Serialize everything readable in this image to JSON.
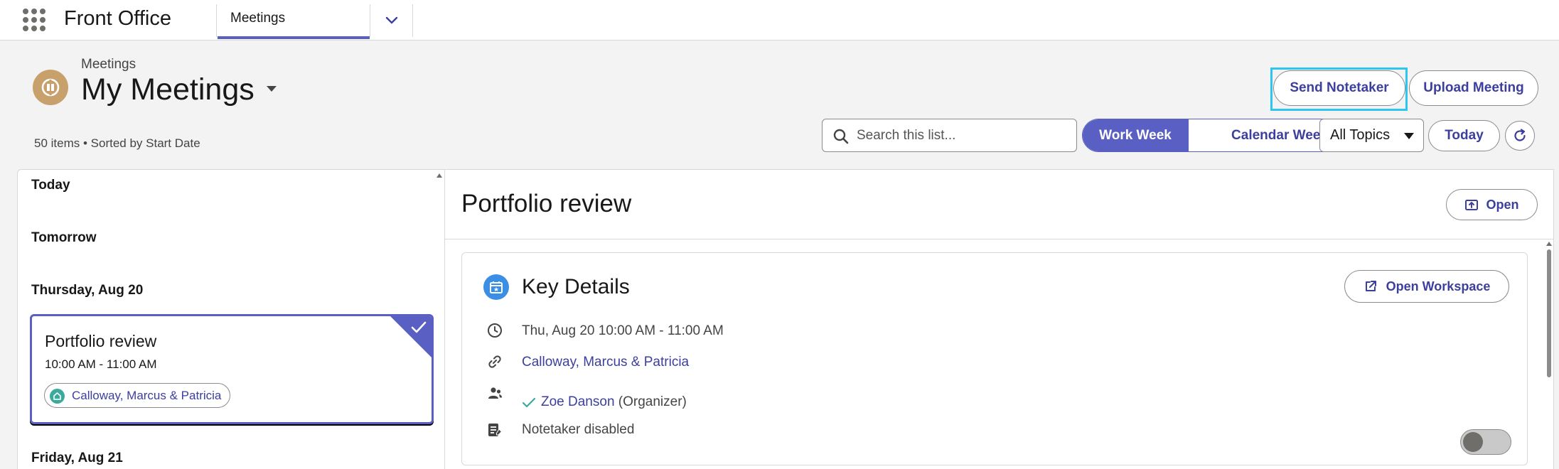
{
  "app": {
    "name": "Front Office",
    "nav_tab": "Meetings"
  },
  "header": {
    "object_label": "Meetings",
    "list_title": "My Meetings",
    "list_meta": "50 items • Sorted by Start Date",
    "send_notetaker_label": "Send Notetaker",
    "upload_meeting_label": "Upload Meeting"
  },
  "toolbar": {
    "search_placeholder": "Search this list...",
    "work_week_label": "Work Week",
    "calendar_week_label": "Calendar Week",
    "topic_selected": "All Topics",
    "today_label": "Today"
  },
  "list": {
    "groups": [
      "Today",
      "Tomorrow",
      "Thursday, Aug 20",
      "Friday, Aug 21"
    ],
    "selected_card": {
      "title": "Portfolio review",
      "time": "10:00 AM - 11:00 AM",
      "chip": "Calloway, Marcus & Patricia"
    }
  },
  "detail": {
    "title": "Portfolio review",
    "open_label": "Open",
    "key_details": {
      "title": "Key Details",
      "open_workspace_label": "Open Workspace",
      "datetime": "Thu, Aug 20 10:00 AM - 11:00 AM",
      "related": "Calloway, Marcus & Patricia",
      "organizer_name": "Zoe Danson",
      "organizer_role": "(Organizer)",
      "notetaker_status": "Notetaker disabled"
    }
  },
  "colors": {
    "brand": "#5a5fc4",
    "link": "#3c3f9e",
    "focus_ring": "#30c5ee",
    "object_icon": "#c8a06b",
    "account_chip": "#3ba99c",
    "key_details_icon": "#3a8ee6"
  },
  "icons": {
    "launcher": "app-launcher-icon",
    "chevron": "chevron-down-icon",
    "meeting": "meeting-icon",
    "search": "search-icon",
    "refresh": "refresh-icon",
    "check": "check-icon",
    "clock": "clock-icon",
    "link": "link-icon",
    "people": "people-icon",
    "notetaker": "notetaker-icon",
    "open": "open-icon",
    "external": "external-link-icon",
    "calendar": "calendar-icon"
  }
}
